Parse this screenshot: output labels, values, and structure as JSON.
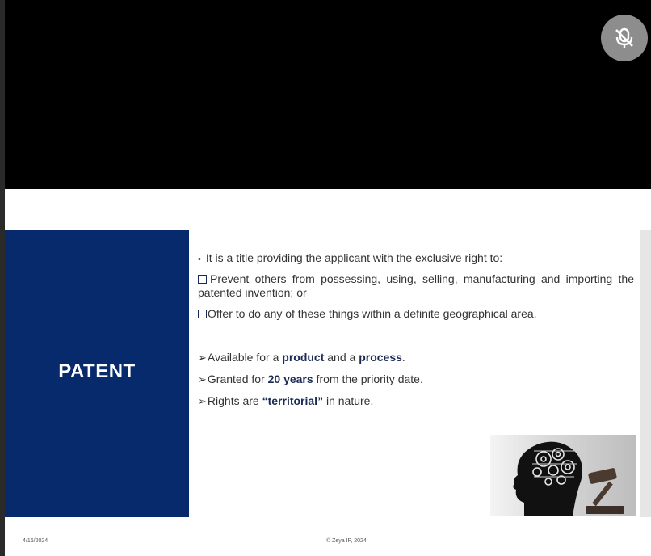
{
  "meeting": {
    "mute_button": "microphone-muted-icon"
  },
  "slide": {
    "title": "PATENT",
    "intro_bullet": "•",
    "intro": "It is a title providing the applicant with the exclusive right to:",
    "option1": "Prevent others from possessing, using, selling, manufacturing and importing the patented invention; or",
    "option2": "Offer to do any of these things within a definite geographical area.",
    "point1": {
      "pre": "Available for a ",
      "b1": "product",
      "mid": " and a ",
      "b2": "process",
      "post": "."
    },
    "point2": {
      "pre": "Granted for ",
      "b1": "20 years",
      "post": " from the priority date."
    },
    "point3": {
      "pre": "Rights are ",
      "b1": "“territorial”",
      "post": " in nature."
    },
    "arrow": "➢",
    "image": "head-gears-gavel-illustration"
  },
  "footer": {
    "date": "4/16/2024",
    "copyright": "© Zeya IP, 2024"
  },
  "colors": {
    "title_panel": "#062a6b",
    "bold_text": "#1b2a55"
  }
}
